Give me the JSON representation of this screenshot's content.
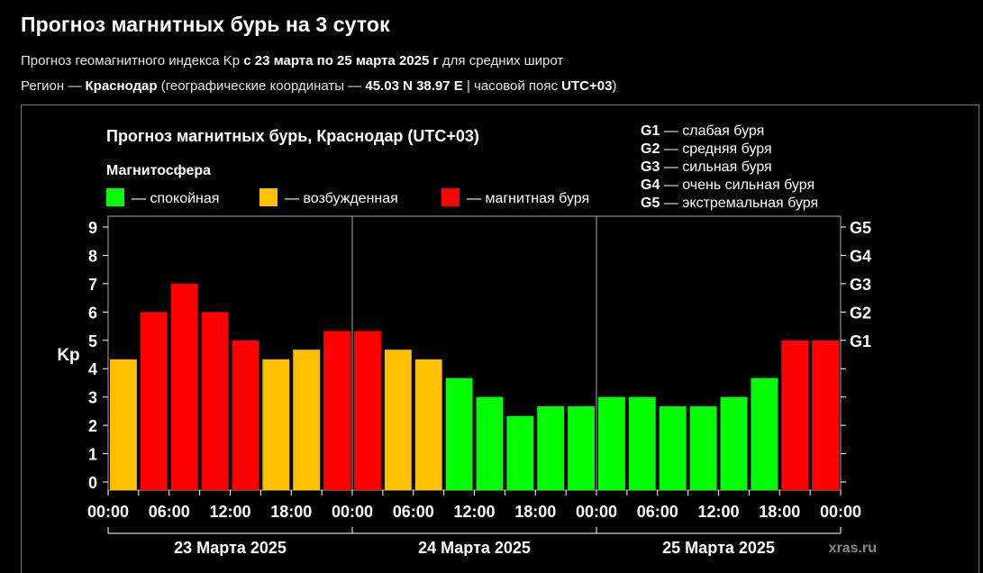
{
  "header": {
    "title": "Прогноз магнитных бурь на 3 суток",
    "line1_prefix": "Прогноз геомагнитного индекса Kp ",
    "line1_bold": "с 23 марта по 25 марта 2025 г",
    "line1_suffix": " для средних широт",
    "line2_prefix": "Регион — ",
    "line2_region": "Краснодар",
    "line2_mid": " (географические координаты — ",
    "line2_coords": "45.03 N 38.97 E",
    "line2_mid2": " | часовой пояс ",
    "line2_tz": "UTC+03",
    "line2_suffix": ")"
  },
  "chart_data": {
    "type": "bar",
    "title": "Прогноз магнитных бурь, Краснодар (UTC+03)",
    "ylabel": "Kp",
    "ylim": [
      0,
      9
    ],
    "yticks": [
      "0",
      "1",
      "2",
      "3",
      "4",
      "5",
      "6",
      "7",
      "8",
      "9"
    ],
    "right_ticks": [
      {
        "kp": 5,
        "label": "G1"
      },
      {
        "kp": 6,
        "label": "G2"
      },
      {
        "kp": 7,
        "label": "G3"
      },
      {
        "kp": 8,
        "label": "G4"
      },
      {
        "kp": 9,
        "label": "G5"
      }
    ],
    "x_tick_labels": [
      "00:00",
      "06:00",
      "12:00",
      "18:00",
      "00:00",
      "06:00",
      "12:00",
      "18:00",
      "00:00",
      "06:00",
      "12:00",
      "18:00",
      "00:00"
    ],
    "days": [
      "23 Марта 2025",
      "24 Марта 2025",
      "25 Марта 2025"
    ],
    "interval_hours": 3,
    "values": [
      4.33,
      6.0,
      7.0,
      6.0,
      5.0,
      4.33,
      4.67,
      5.33,
      5.33,
      4.67,
      4.33,
      3.67,
      3.0,
      2.33,
      2.67,
      2.67,
      3.0,
      3.0,
      2.67,
      2.67,
      3.0,
      3.67,
      5.0,
      5.0
    ],
    "colors": {
      "quiet": "#00ff00",
      "excited": "#ffc000",
      "storm": "#ff0000"
    },
    "legend_title": "Магнитосфера",
    "legend": [
      {
        "key": "quiet",
        "label": "— спокойная"
      },
      {
        "key": "excited",
        "label": "— возбужденная"
      },
      {
        "key": "storm",
        "label": "— магнитная буря"
      }
    ],
    "g_scale": [
      {
        "code": "G1",
        "text": " — слабая буря"
      },
      {
        "code": "G2",
        "text": " — средняя буря"
      },
      {
        "code": "G3",
        "text": " — сильная буря"
      },
      {
        "code": "G4",
        "text": " — очень сильная буря"
      },
      {
        "code": "G5",
        "text": " — экстремальная буря"
      }
    ],
    "watermark": "xras.ru"
  }
}
